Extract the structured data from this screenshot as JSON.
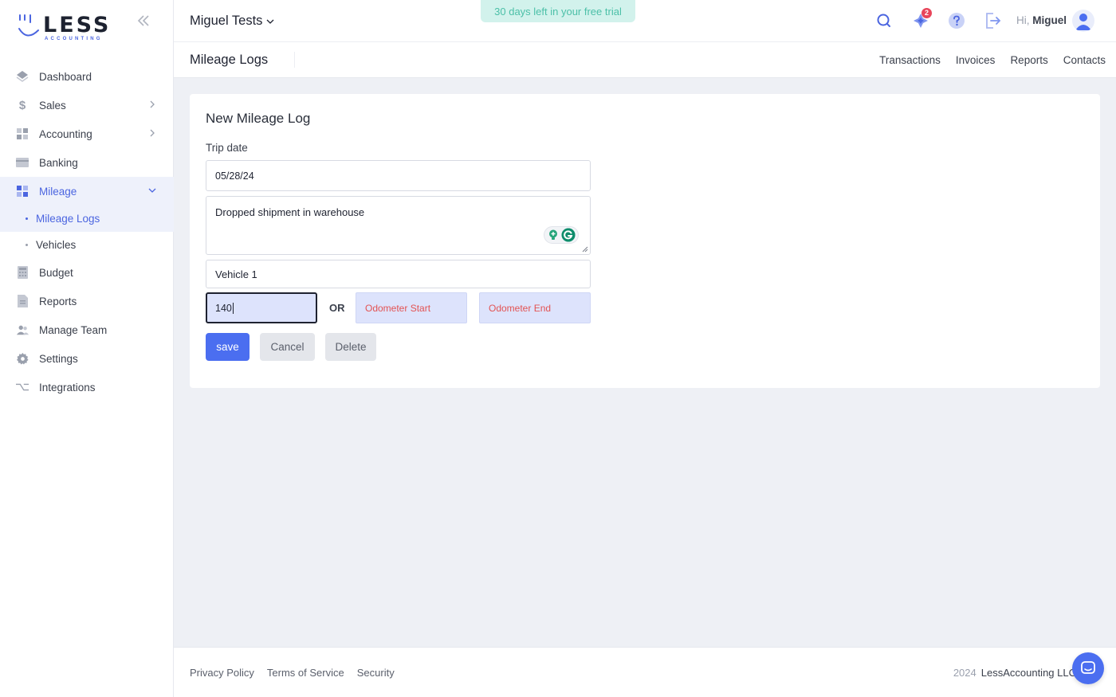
{
  "brand": {
    "word": "LESS",
    "sub": "ACCOUNTING"
  },
  "sidebar": {
    "items": [
      {
        "label": "Dashboard",
        "icon": "dashboard-icon"
      },
      {
        "label": "Sales",
        "icon": "dollar-icon"
      },
      {
        "label": "Accounting",
        "icon": "grid-icon"
      },
      {
        "label": "Banking",
        "icon": "card-icon"
      },
      {
        "label": "Mileage",
        "icon": "mileage-icon"
      },
      {
        "label": "Budget",
        "icon": "calculator-icon"
      },
      {
        "label": "Reports",
        "icon": "report-icon"
      },
      {
        "label": "Manage Team",
        "icon": "team-icon"
      },
      {
        "label": "Settings",
        "icon": "gear-icon"
      },
      {
        "label": "Integrations",
        "icon": "integrations-icon"
      }
    ],
    "mileage_sub": [
      {
        "label": "Mileage Logs"
      },
      {
        "label": "Vehicles"
      }
    ]
  },
  "topbar": {
    "company": "Miguel Tests",
    "trial": "30 days left in your free trial",
    "notifications_count": "2",
    "greeting_prefix": "Hi,",
    "user_name": "Miguel"
  },
  "subheader": {
    "title": "Mileage Logs",
    "links": [
      "Transactions",
      "Invoices",
      "Reports",
      "Contacts"
    ]
  },
  "form": {
    "title": "New Mileage Log",
    "trip_date_label": "Trip date",
    "trip_date": "05/28/24",
    "description": "Dropped shipment in warehouse",
    "vehicle": "Vehicle 1",
    "miles": "140",
    "or_label": "OR",
    "odometer_start_placeholder": "Odometer Start",
    "odometer_end_placeholder": "Odometer End",
    "save_label": "save",
    "cancel_label": "Cancel",
    "delete_label": "Delete"
  },
  "footer": {
    "links": [
      "Privacy Policy",
      "Terms of Service",
      "Security"
    ],
    "year": "2024",
    "company": "LessAccounting LLC"
  },
  "colors": {
    "accent": "#4b6ef0",
    "active_nav": "#4b65e0",
    "trial_bg": "#d2f2ec",
    "trial_text": "#4cc0a8",
    "error_text": "#e35353",
    "badge": "#e8455a"
  }
}
